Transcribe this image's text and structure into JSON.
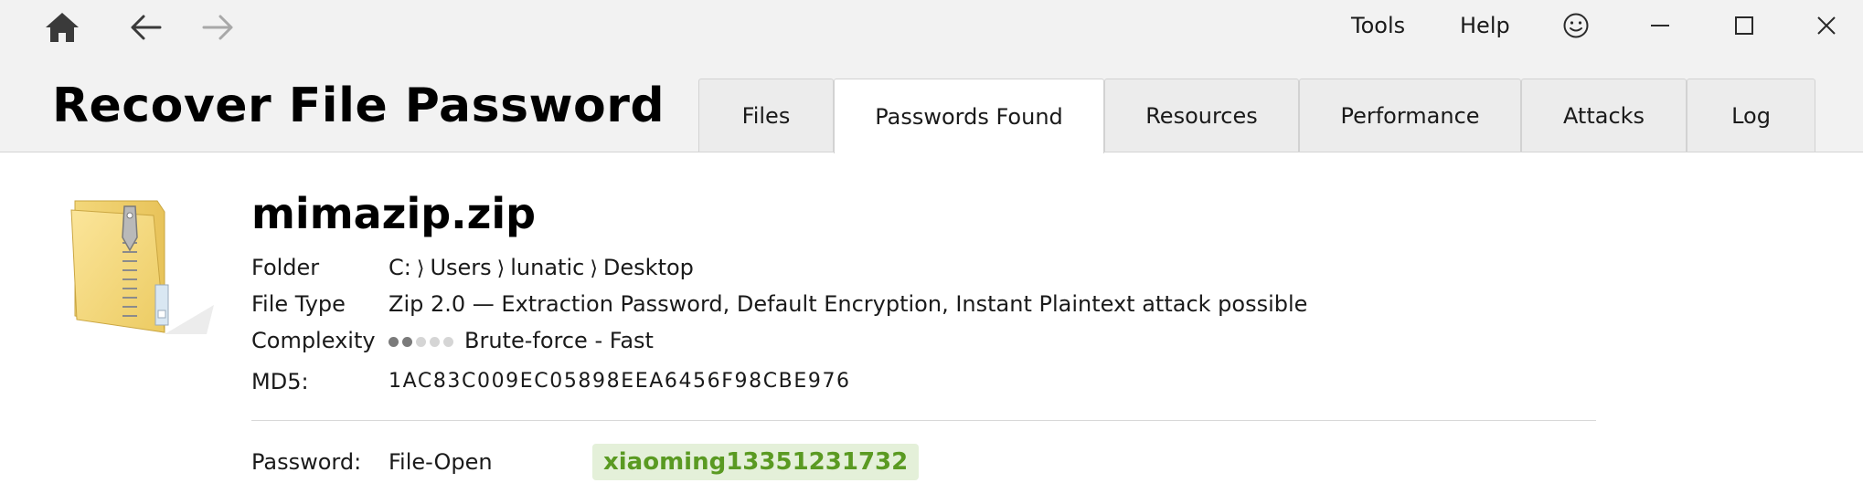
{
  "app": {
    "title": "Recover File Password"
  },
  "menu": {
    "tools": "Tools",
    "help": "Help"
  },
  "tabs": [
    {
      "label": "Files",
      "active": false
    },
    {
      "label": "Passwords Found",
      "active": true
    },
    {
      "label": "Resources",
      "active": false
    },
    {
      "label": "Performance",
      "active": false
    },
    {
      "label": "Attacks",
      "active": false
    },
    {
      "label": "Log",
      "active": false
    }
  ],
  "icons": {
    "home": "home-icon",
    "back": "arrow-left-icon",
    "forward": "arrow-right-icon",
    "feedback": "smiley-icon",
    "minimize": "minimize-icon",
    "maximize": "maximize-icon",
    "close": "close-icon",
    "file": "zip-folder-icon"
  },
  "colors": {
    "header_bg": "#f2f2f2",
    "password_text": "#5a9a22",
    "password_bg": "#e4f0d9",
    "forward_disabled": "#a8a8a8"
  },
  "file": {
    "name": "mimazip.zip",
    "folder_label": "Folder",
    "folder_path": [
      "C:",
      "Users",
      "lunatic",
      "Desktop"
    ],
    "folder_separator": "⟩",
    "type_label": "File Type",
    "type_value": "Zip 2.0 — Extraction Password, Default Encryption, Instant Plaintext attack possible",
    "complexity_label": "Complexity",
    "complexity_level": 2,
    "complexity_max": 5,
    "complexity_value": "Brute-force - Fast",
    "md5_label": "MD5:",
    "md5_value": "1AC83C009EC05898EEA6456F98CBE976"
  },
  "password": {
    "label": "Password:",
    "kind": "File-Open",
    "value": "xiaoming13351231732"
  }
}
